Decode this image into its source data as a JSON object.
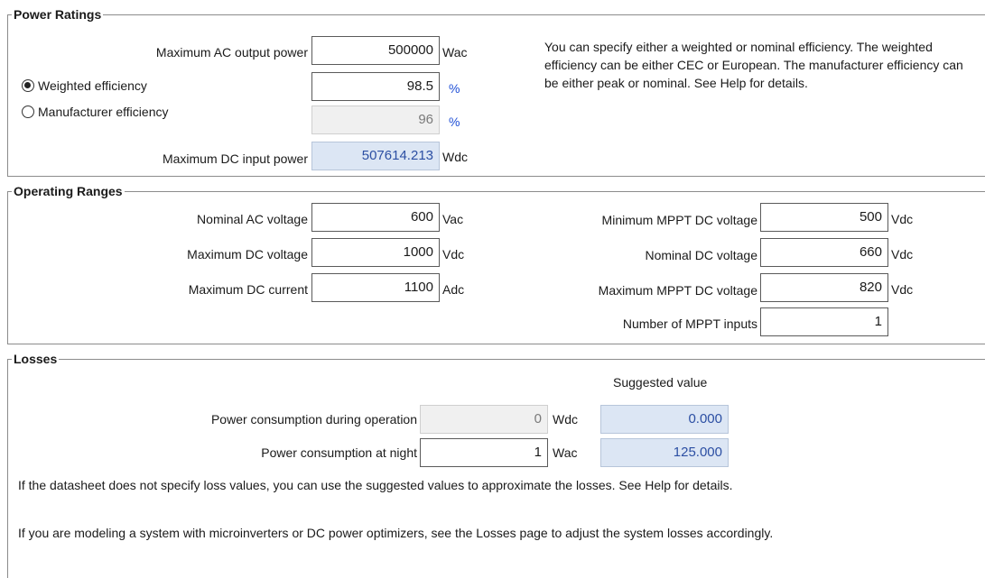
{
  "power_ratings": {
    "title": "Power Ratings",
    "max_ac_output": {
      "label": "Maximum AC output power",
      "value": "500000",
      "unit": "Wac"
    },
    "weighted": {
      "label": "Weighted efficiency",
      "value": "98.5",
      "unit": "%",
      "selected": true
    },
    "manufacturer": {
      "label": "Manufacturer efficiency",
      "value": "96",
      "unit": "%",
      "selected": false
    },
    "max_dc_input": {
      "label": "Maximum DC input power",
      "value": "507614.213",
      "unit": "Wdc"
    },
    "info_text": "You can specify either a weighted or nominal efficiency. The weighted efficiency can be either CEC or European. The manufacturer efficiency can be either peak or nominal. See Help for details."
  },
  "operating_ranges": {
    "title": "Operating Ranges",
    "nominal_ac_voltage": {
      "label": "Nominal AC voltage",
      "value": "600",
      "unit": "Vac"
    },
    "max_dc_voltage": {
      "label": "Maximum DC voltage",
      "value": "1000",
      "unit": "Vdc"
    },
    "max_dc_current": {
      "label": "Maximum DC current",
      "value": "1100",
      "unit": "Adc"
    },
    "min_mppt_voltage": {
      "label": "Minimum MPPT DC voltage",
      "value": "500",
      "unit": "Vdc"
    },
    "nominal_dc_voltage": {
      "label": "Nominal DC voltage",
      "value": "660",
      "unit": "Vdc"
    },
    "max_mppt_voltage": {
      "label": "Maximum MPPT DC voltage",
      "value": "820",
      "unit": "Vdc"
    },
    "mppt_inputs": {
      "label": "Number of MPPT inputs",
      "value": "1"
    }
  },
  "losses": {
    "title": "Losses",
    "suggested_header": "Suggested value",
    "operation": {
      "label": "Power consumption during operation",
      "value": "0",
      "unit": "Wdc",
      "suggested": "0.000"
    },
    "night": {
      "label": "Power consumption at night",
      "value": "1",
      "unit": "Wac",
      "suggested": "125.000"
    },
    "note1": "If the datasheet does not specify loss values, you can use the suggested values to approximate the losses. See Help for details.",
    "note2": "If you are modeling a system with microinverters or DC power optimizers, see the Losses page to adjust the system losses accordingly."
  }
}
